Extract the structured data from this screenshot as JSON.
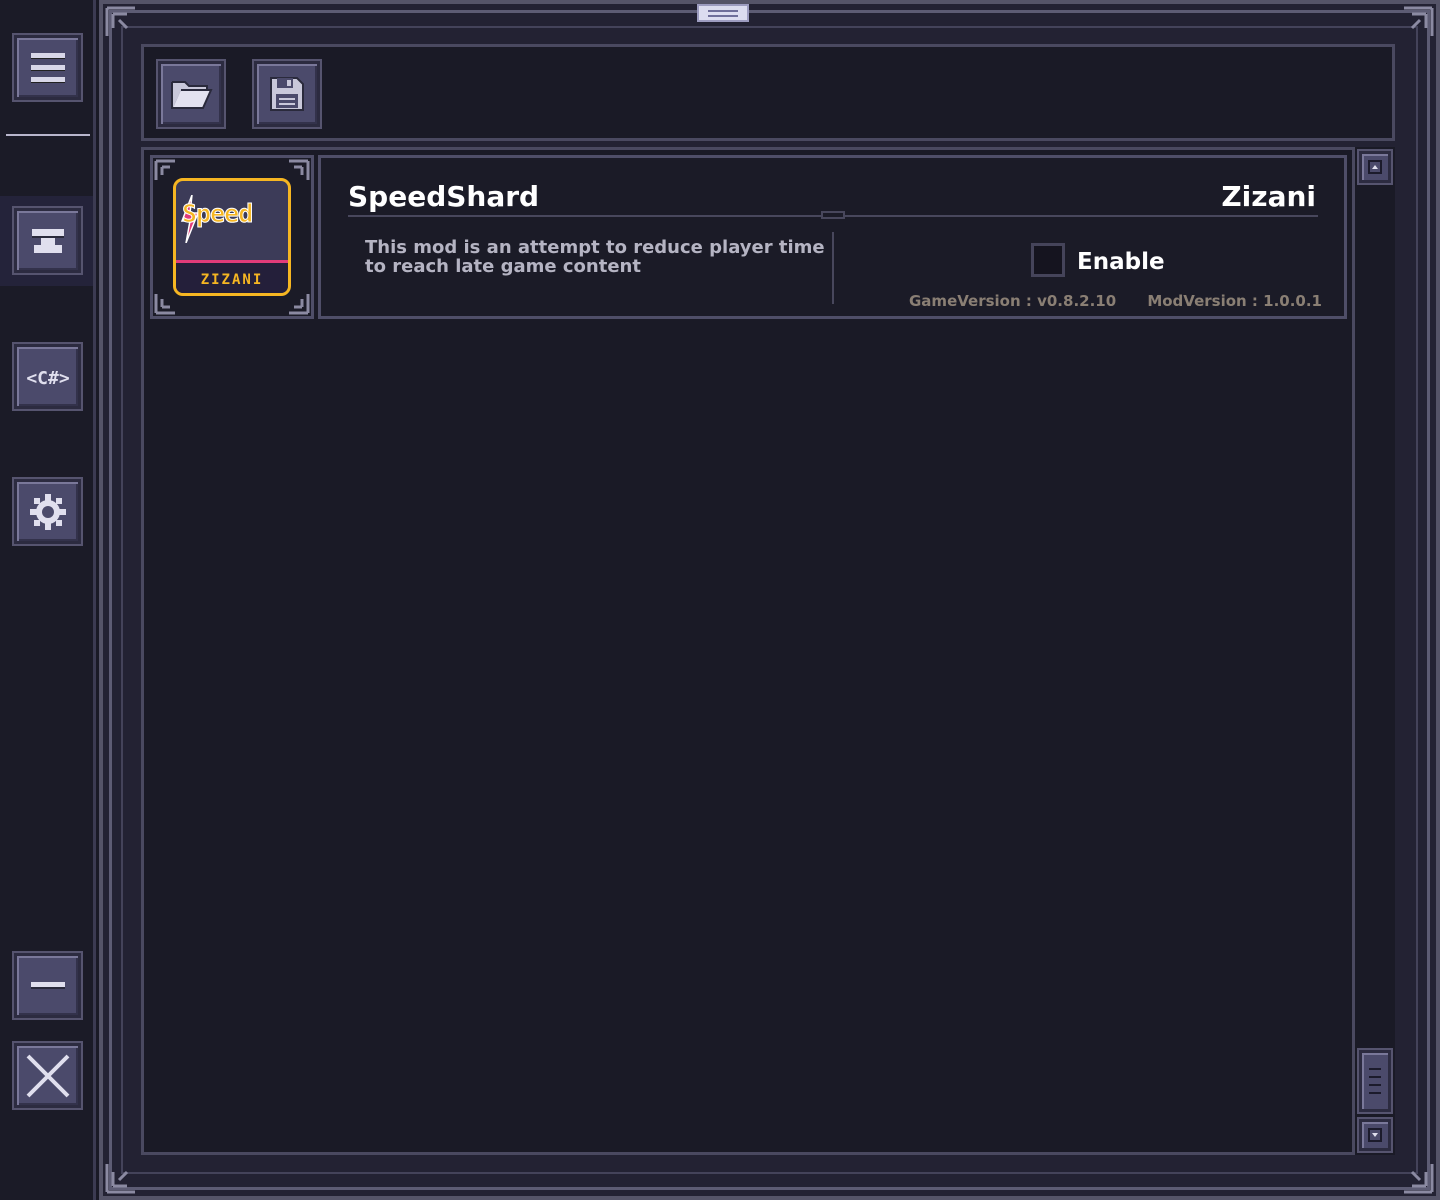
{
  "sidebar": {
    "items": [
      {
        "name": "menu"
      },
      {
        "name": "mods-anvil"
      },
      {
        "name": "csharp-code"
      },
      {
        "name": "settings"
      },
      {
        "name": "minimize"
      },
      {
        "name": "close"
      }
    ]
  },
  "toolbar": {
    "open_folder_icon": "folder-open-icon",
    "save_icon": "floppy-disk-icon"
  },
  "mods": [
    {
      "title": "SpeedShard",
      "author": "Zizani",
      "description": "This mod is an attempt to reduce player time to reach late game content",
      "enable_label": "Enable",
      "enabled": false,
      "game_version_label": "GameVersion : v0.8.2.10",
      "mod_version_label": "ModVersion : 1.0.0.1",
      "icon_word": "Speed",
      "icon_author": "ZIZANI"
    }
  ],
  "colors": {
    "background": "#1a1a26",
    "button": "#4b4a6b",
    "accent_yellow": "#f6b622",
    "accent_pink": "#e23b7a",
    "version_text": "#8a7f74"
  }
}
